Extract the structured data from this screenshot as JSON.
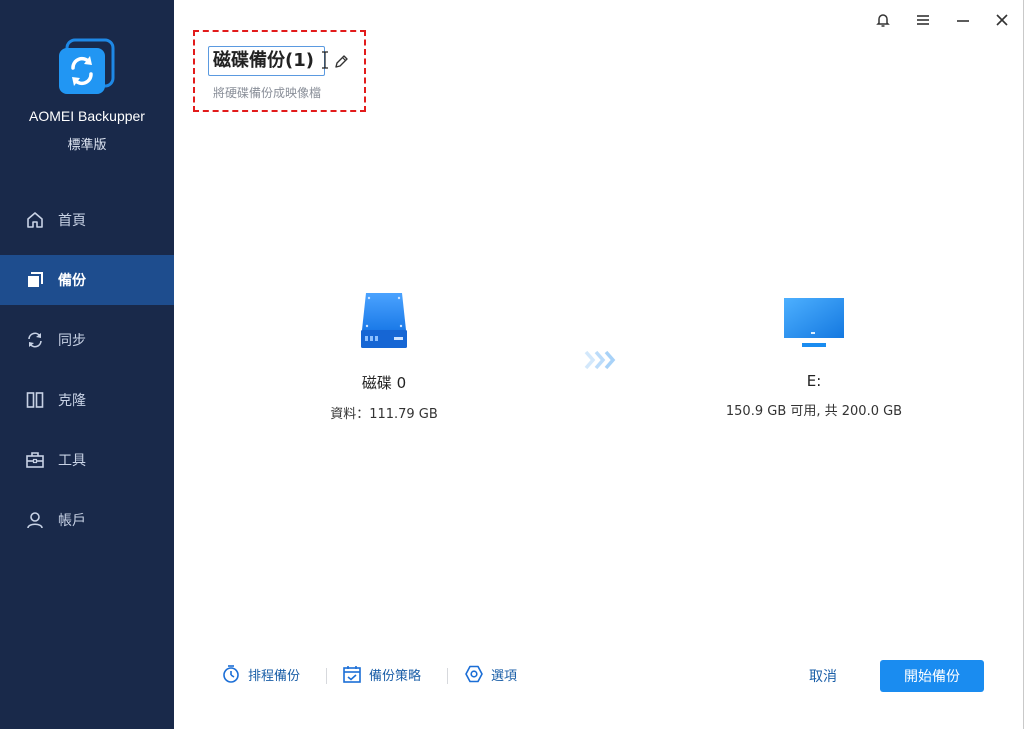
{
  "app": {
    "name": "AOMEI Backupper",
    "edition": "標準版"
  },
  "sidebar": {
    "items": [
      {
        "label": "首頁",
        "icon": "home-icon",
        "active": false
      },
      {
        "label": "備份",
        "icon": "backup-icon",
        "active": true
      },
      {
        "label": "同步",
        "icon": "sync-icon",
        "active": false
      },
      {
        "label": "克隆",
        "icon": "clone-icon",
        "active": false
      },
      {
        "label": "工具",
        "icon": "toolbox-icon",
        "active": false
      },
      {
        "label": "帳戶",
        "icon": "user-icon",
        "active": false
      }
    ]
  },
  "window": {
    "controls": [
      "bell-icon",
      "menu-icon",
      "minimize-icon",
      "close-icon"
    ]
  },
  "task": {
    "name": "磁碟備份(1)",
    "subtitle": "將硬碟備份成映像檔"
  },
  "source": {
    "label": "磁碟 0",
    "info": "資料：111.79 GB",
    "icon": "hard-disk-icon"
  },
  "destination": {
    "label": "E:",
    "info": "150.9 GB 可用, 共 200.0 GB",
    "icon": "monitor-icon"
  },
  "bottom": {
    "schedule": "排程備份",
    "scheme": "備份策略",
    "options": "選項",
    "cancel": "取消",
    "start": "開始備份"
  },
  "colors": {
    "sidebar_bg": "#19294a",
    "sidebar_active": "#1e4d8e",
    "accent": "#1a8cf0",
    "highlight_border": "#e21b1b"
  }
}
